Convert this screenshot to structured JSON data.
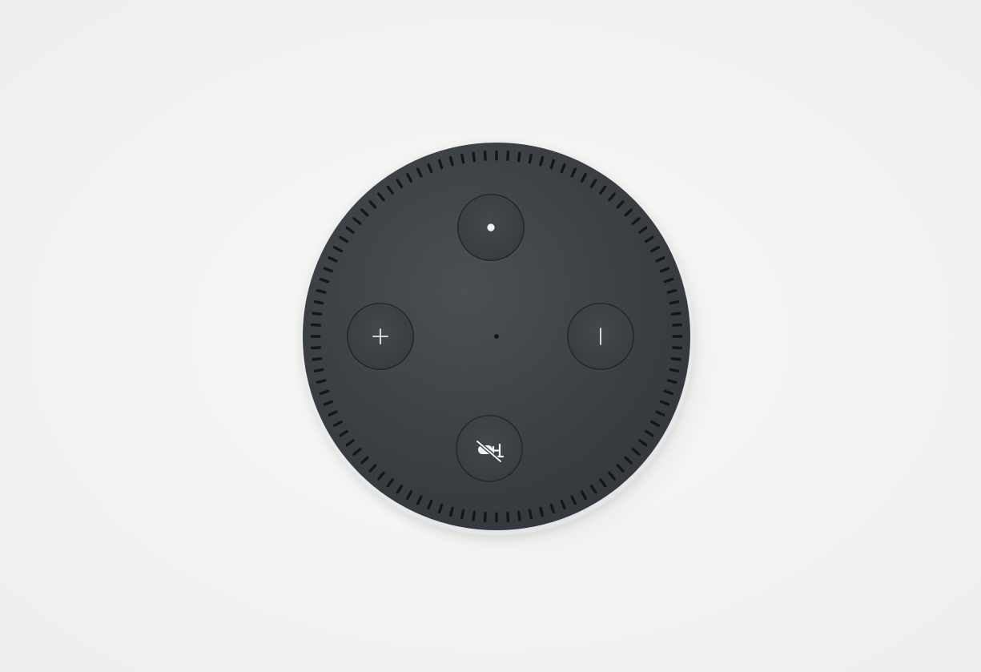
{
  "scene": {
    "subject": "smart-speaker",
    "background_color": "#f3f3f1",
    "device_top_color": "#3b4045",
    "device_rim_color": "#e6eaec",
    "button_icon_color": "#f2f2f2"
  },
  "speaker": {
    "grille_hole_count": 100,
    "buttons": [
      {
        "name": "action-button",
        "icon": "dot-icon"
      },
      {
        "name": "volume-up-button",
        "icon": "plus-icon"
      },
      {
        "name": "volume-down-button",
        "icon": "minus-icon"
      },
      {
        "name": "microphone-off-button",
        "icon": "microphone-off-icon"
      }
    ]
  }
}
